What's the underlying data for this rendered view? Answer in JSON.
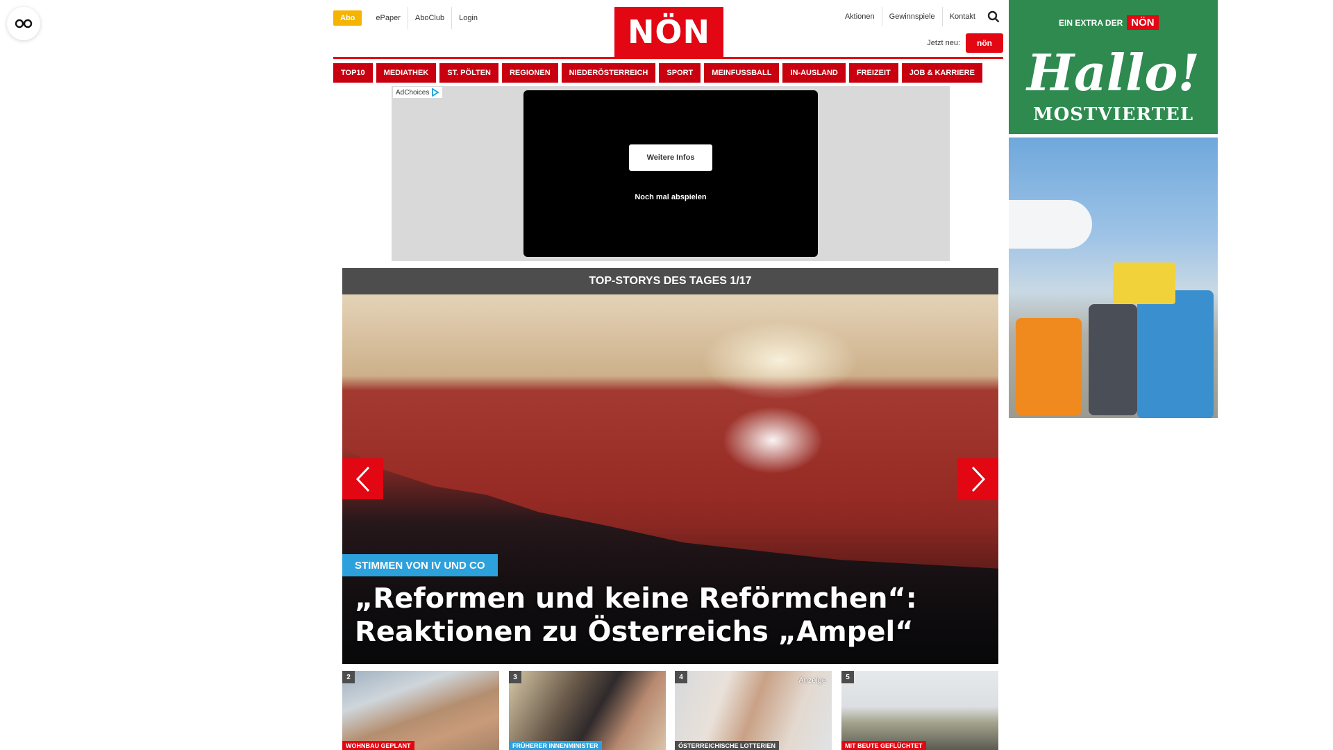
{
  "header": {
    "abo_label": "Abo",
    "top_links_left": [
      "ePaper",
      "AboClub",
      "Login"
    ],
    "logo_text": "NÖN",
    "top_links_right": [
      "Aktionen",
      "Gewinnspiele",
      "Kontakt"
    ],
    "jetzt_neu_label": "Jetzt neu:",
    "jetzt_neu_logo": "nön"
  },
  "main_nav": [
    "TOP10",
    "MEDIATHEK",
    "ST. PÖLTEN",
    "REGIONEN",
    "NIEDERÖSTERREICH",
    "SPORT",
    "MEINFUSSBALL",
    "IN-AUSLAND",
    "FREIZEIT",
    "JOB & KARRIERE"
  ],
  "ad": {
    "adchoices_label": "AdChoices",
    "more_info_label": "Weitere Infos",
    "replay_label": "Noch mal abspielen"
  },
  "top_stories": {
    "bar_title": "TOP-STORYS DES TAGES 1/17",
    "hero_tag": "STIMMEN VON IV UND CO",
    "hero_headline_line1": "„Reformen und keine Reförmchen“:",
    "hero_headline_line2": "Reaktionen zu Österreichs „Ampel“"
  },
  "thumbnails": [
    {
      "number": "2",
      "label": "WOHNBAU GEPLANT",
      "label_color": "#e30613"
    },
    {
      "number": "3",
      "label": "FRÜHERER INNENMINISTER",
      "label_color": "#2ca1dc"
    },
    {
      "number": "4",
      "label": "ÖSTERREICHISCHE LOTTERIEN",
      "label_color": "#4d4d4d",
      "ad_label": "Anzeige"
    },
    {
      "number": "5",
      "label": "MIT BEUTE GEFLÜCHTET",
      "label_color": "#e30613"
    }
  ],
  "side_ad": {
    "extra_label": "EIN EXTRA DER",
    "extra_logo": "NÖN",
    "hallo": "Hallo!",
    "region": "MOSTVIERTEL"
  },
  "colors": {
    "brand_red": "#e30613",
    "nav_red": "#c8000f",
    "abo_yellow": "#f5b400",
    "tag_blue": "#2ca1dc",
    "side_green": "#2e8a4f"
  },
  "icons": [
    "glasses-icon",
    "search-icon",
    "adchoices-icon",
    "chevron-left-icon",
    "chevron-right-icon"
  ]
}
